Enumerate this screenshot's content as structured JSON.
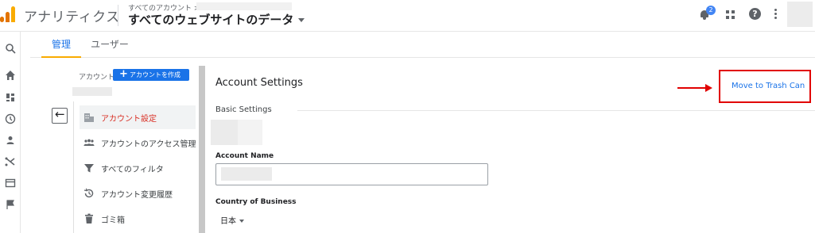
{
  "header": {
    "app_title": "アナリティクス",
    "breadcrumb": "すべてのアカウント >",
    "property_name": "すべてのウェブサイトのデータ",
    "notification_count": "2",
    "help_glyph": "?"
  },
  "tabs": [
    {
      "label": "管理"
    },
    {
      "label": "ユーザー"
    }
  ],
  "admin_nav": {
    "account_label": "アカウント",
    "create_button": "アカウントを作成",
    "back_glyph": "←",
    "items": [
      {
        "label": "アカウント設定",
        "icon": "building-icon"
      },
      {
        "label": "アカウントのアクセス管理",
        "icon": "people-icon"
      },
      {
        "label": "すべてのフィルタ",
        "icon": "filter-icon"
      },
      {
        "label": "アカウント変更履歴",
        "icon": "history-icon"
      },
      {
        "label": "ゴミ箱",
        "icon": "trash-icon"
      }
    ]
  },
  "settings": {
    "title": "Account Settings",
    "trash_link": "Move to Trash Can",
    "basic_settings": "Basic Settings",
    "account_name_label": "Account Name",
    "country_label": "Country of Business",
    "country_value": "日本"
  },
  "colors": {
    "accent_blue": "#1a73e8",
    "tab_underline": "#f9ab00",
    "active_nav_text": "#d93025",
    "annotation_red": "#e10000"
  }
}
